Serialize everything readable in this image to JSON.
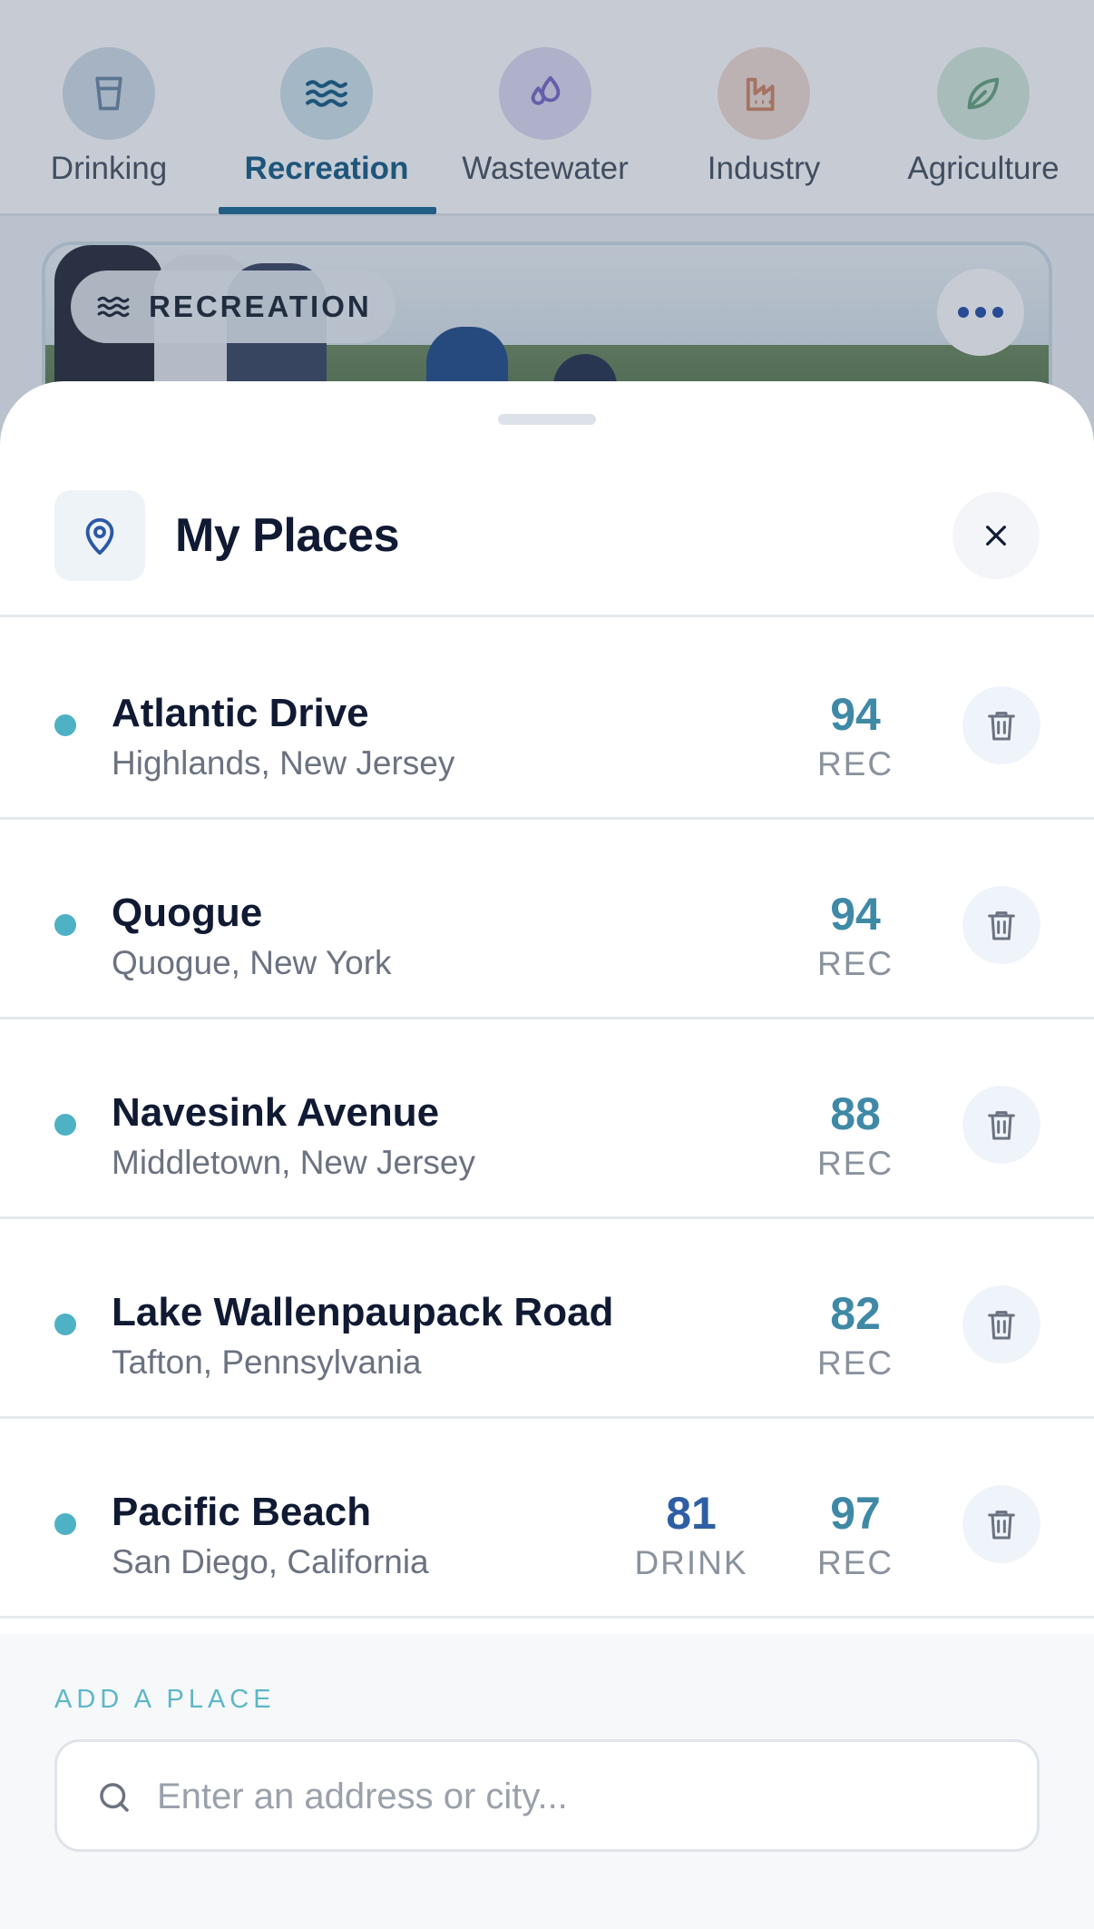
{
  "tabs": [
    {
      "label": "Drinking",
      "icon": "cup-icon",
      "color": "#6e8aa5",
      "bg": "#d3dde7",
      "active": false
    },
    {
      "label": "Recreation",
      "icon": "waves-icon",
      "color": "#1b5f86",
      "bg": "#cfe3ea",
      "active": true
    },
    {
      "label": "Wastewater",
      "icon": "droplets-icon",
      "color": "#7b6bc9",
      "bg": "#dfd9f1",
      "active": false
    },
    {
      "label": "Industry",
      "icon": "factory-icon",
      "color": "#d08866",
      "bg": "#f1dcd3",
      "active": false
    },
    {
      "label": "Agriculture",
      "icon": "leaf-icon",
      "color": "#6aa57e",
      "bg": "#d5ebdc",
      "active": false
    }
  ],
  "hero": {
    "badge_label": "RECREATION",
    "badge_icon": "waves-icon",
    "more_icon": "ellipsis-icon"
  },
  "sheet": {
    "title": "My Places",
    "title_icon": "map-pin-icon",
    "close_icon": "close-icon",
    "accent_color": "#4fb1c4"
  },
  "places": [
    {
      "name": "Atlantic Drive",
      "location": "Highlands, New Jersey",
      "rec_score": "94",
      "rec_label": "REC"
    },
    {
      "name": "Quogue",
      "location": "Quogue, New York",
      "rec_score": "94",
      "rec_label": "REC"
    },
    {
      "name": "Navesink Avenue",
      "location": "Middletown, New Jersey",
      "rec_score": "88",
      "rec_label": "REC"
    },
    {
      "name": "Lake Wallenpaupack Road",
      "location": "Tafton, Pennsylvania",
      "rec_score": "82",
      "rec_label": "REC"
    },
    {
      "name": "Pacific Beach",
      "location": "San Diego, California",
      "drink_score": "81",
      "drink_label": "DRINK",
      "rec_score": "97",
      "rec_label": "REC"
    }
  ],
  "add_place": {
    "label": "ADD A PLACE",
    "placeholder": "Enter an address or city...",
    "value": "",
    "icon": "search-icon"
  }
}
